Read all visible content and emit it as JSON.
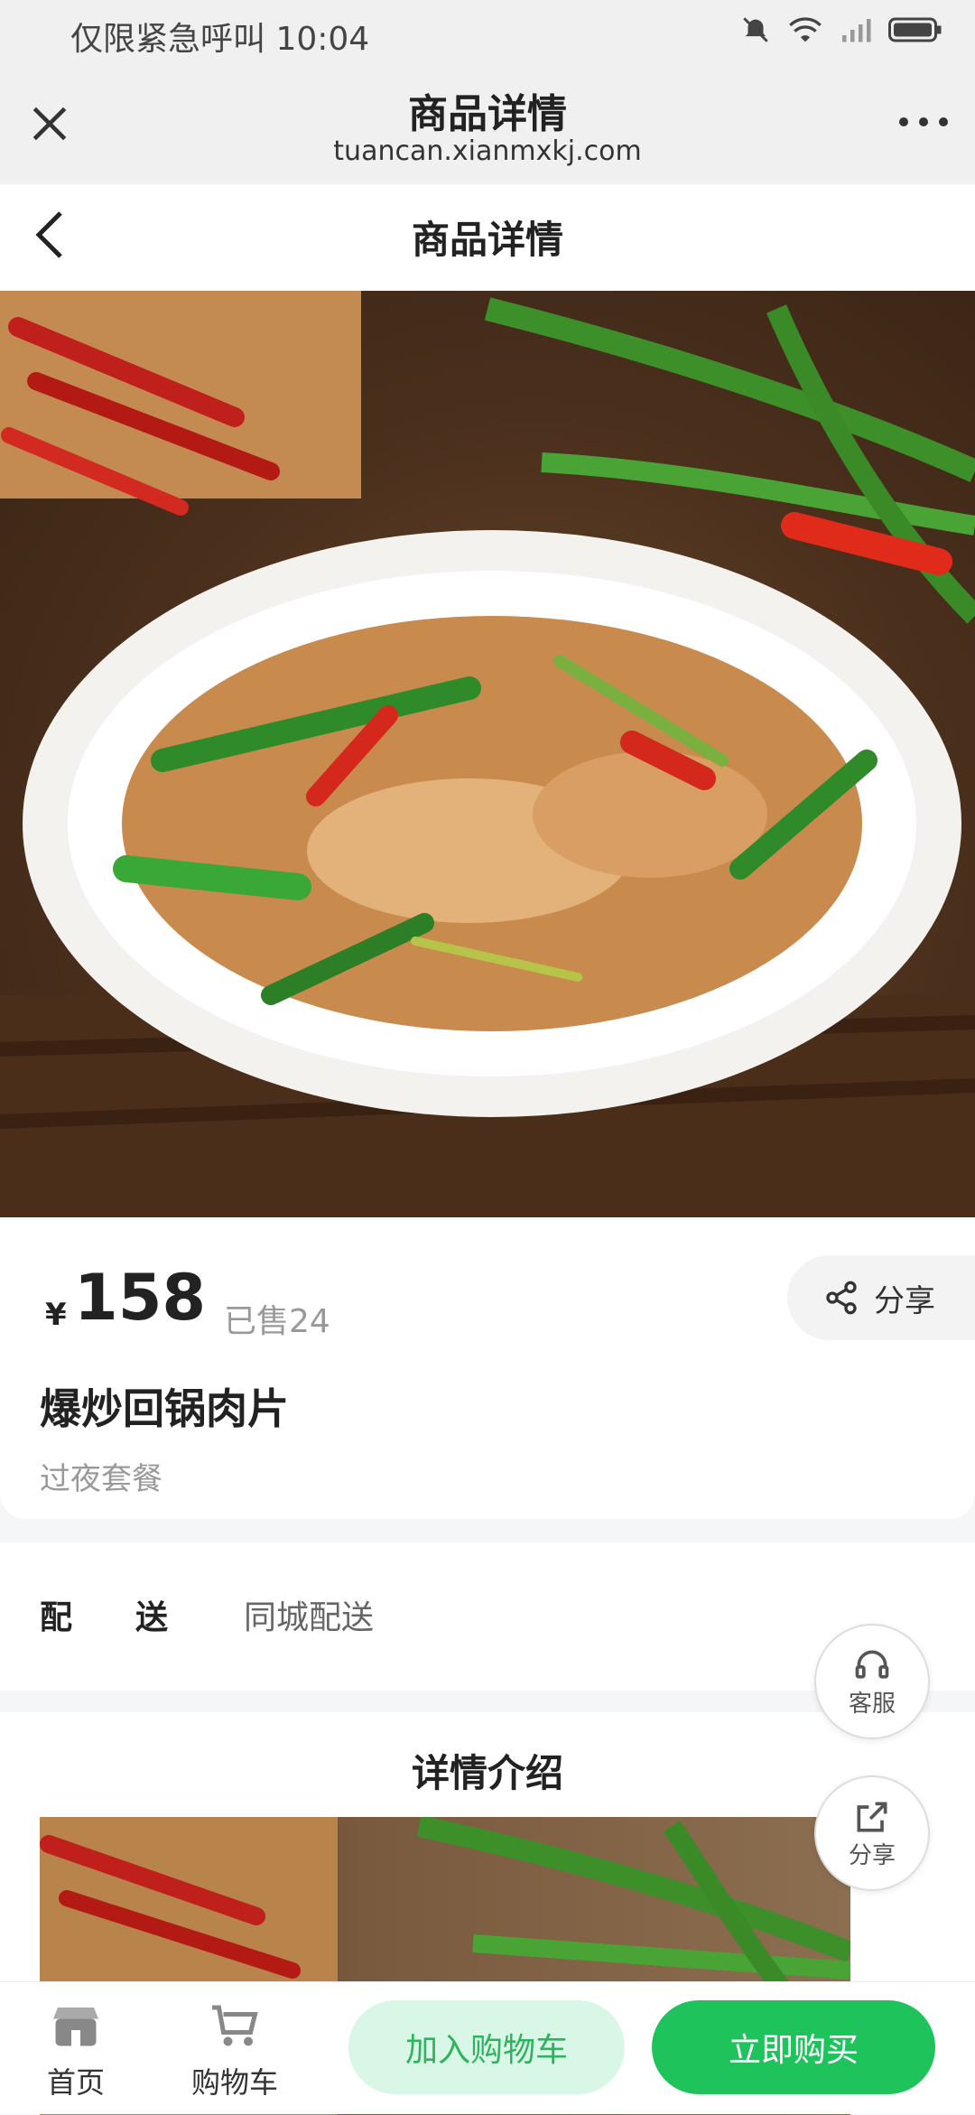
{
  "status": {
    "left_text": "仅限紧急呼叫 10:04"
  },
  "browser": {
    "title": "商品详情",
    "url": "tuancan.xianmxkj.com"
  },
  "app": {
    "title": "商品详情"
  },
  "product": {
    "currency": "¥",
    "price": "158",
    "sold": "已售24",
    "name": "爆炒回锅肉片",
    "subtitle": "过夜套餐",
    "share_label": "分享"
  },
  "delivery": {
    "label": "配送",
    "value": "同城配送"
  },
  "details": {
    "title": "详情介绍"
  },
  "floating": {
    "service_label": "客服",
    "share_label": "分享"
  },
  "bottom_bar": {
    "home_label": "首页",
    "cart_label": "购物车",
    "add_cart_label": "加入购物车",
    "buy_now_label": "立即购买"
  },
  "colors": {
    "accent": "#1fc35c",
    "accent_light": "#d9f7e6",
    "page_bg": "#f5f6f8"
  }
}
